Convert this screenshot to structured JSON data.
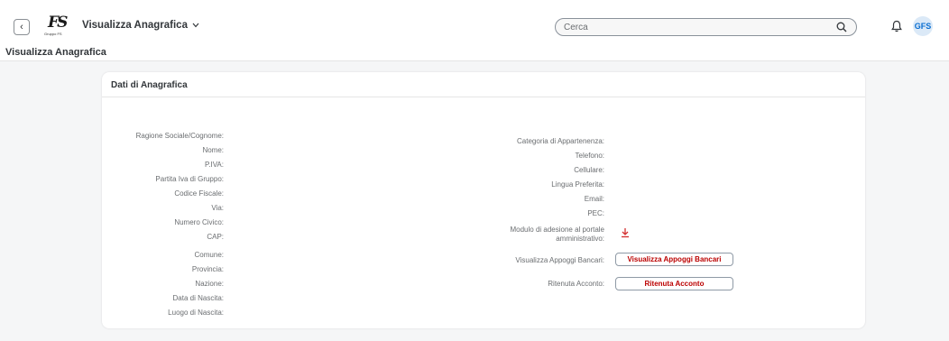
{
  "shell": {
    "back_glyph": "‹",
    "logo_mark": "FS",
    "logo_sub": "Gruppo FS",
    "app_title": "Visualizza Anagrafica",
    "search_placeholder": "Cerca",
    "avatar_initials": "GFS"
  },
  "page": {
    "title": "Visualizza Anagrafica"
  },
  "panel": {
    "title": "Dati di Anagrafica",
    "left_labels": [
      "Ragione Sociale/Cognome:",
      "Nome:",
      "P.IVA:",
      "Partita Iva di Gruppo:",
      "Codice Fiscale:",
      "Via:",
      "Numero Civico:",
      "CAP:",
      "Comune:",
      "Provincia:",
      "Nazione:",
      "Data di Nascita:",
      "Luogo di Nascita:"
    ],
    "right_labels": {
      "categoria": "Categoria di Appartenenza:",
      "telefono": "Telefono:",
      "cellulare": "Cellulare:",
      "lingua": "Lingua Preferita:",
      "email": "Email:",
      "pec": "PEC:",
      "modulo_line1": "Modulo di adesione al portale",
      "modulo_line2": "amministrativo:",
      "appoggi": "Visualizza Appoggi Bancari:",
      "ritenuta": "Ritenuta Acconto:"
    },
    "buttons": {
      "appoggi": "Visualizza Appoggi Bancari",
      "ritenuta": "Ritenuta Acconto"
    }
  },
  "colors": {
    "accent": "#0a6ed1",
    "button_text": "#bb0000",
    "download_icon": "#d32f2f"
  }
}
